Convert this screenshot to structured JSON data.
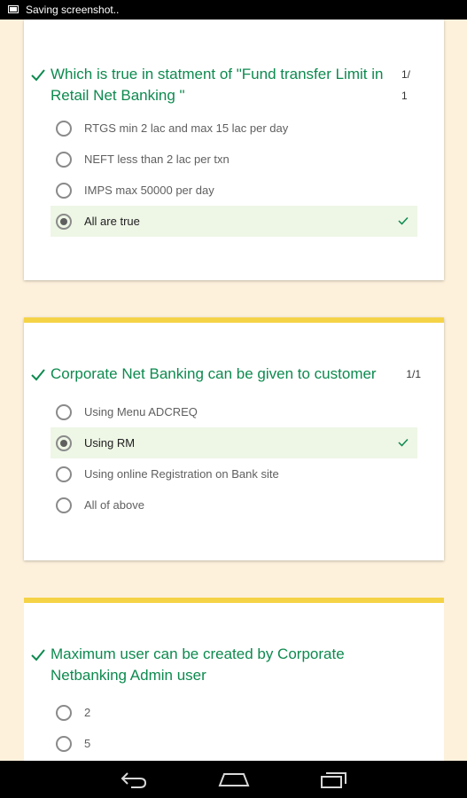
{
  "status_bar": {
    "text": "Saving screenshot..",
    "icon": "screenshot-icon"
  },
  "questions": [
    {
      "text": "Which is true in statment of \"Fund transfer Limit in Retail Net Banking \"",
      "score_top": "1/",
      "score_bottom": "1",
      "options": [
        {
          "label": "RTGS min 2 lac and max 15 lac per day",
          "selected": false,
          "correct": false
        },
        {
          "label": "NEFT less than 2 lac per txn",
          "selected": false,
          "correct": false
        },
        {
          "label": "IMPS max 50000 per day",
          "selected": false,
          "correct": false
        },
        {
          "label": "All are true",
          "selected": true,
          "correct": true
        }
      ]
    },
    {
      "text": "Corporate Net Banking can be given to customer",
      "score": "1/1",
      "options": [
        {
          "label": "Using Menu ADCREQ",
          "selected": false,
          "correct": false
        },
        {
          "label": "Using RM",
          "selected": true,
          "correct": true
        },
        {
          "label": "Using online Registration on Bank site",
          "selected": false,
          "correct": false
        },
        {
          "label": "All of above",
          "selected": false,
          "correct": false
        }
      ]
    },
    {
      "text": "Maximum user can be created by Corporate Netbanking Admin user",
      "options": [
        {
          "label": "2",
          "selected": false,
          "correct": false
        },
        {
          "label": "5",
          "selected": false,
          "correct": false
        }
      ]
    }
  ],
  "nav_bar": {
    "buttons": [
      "back-icon",
      "home-icon",
      "recent-apps-icon"
    ]
  },
  "colors": {
    "accent_green": "#0d8a4f",
    "card_top": "#f5d346",
    "page_bg": "#fdf1dc",
    "correct_bg": "#eef6e6"
  }
}
